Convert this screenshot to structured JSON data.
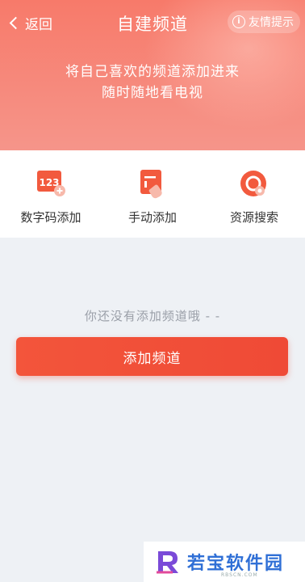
{
  "header": {
    "back_label": "返回",
    "title": "自建频道",
    "tip_label": "友情提示",
    "slogan_line1": "将自己喜欢的频道添加进来",
    "slogan_line2": "随时随地看电视"
  },
  "actions": [
    {
      "label": "数字码添加",
      "icon": "number-code-icon",
      "icon_text": "123"
    },
    {
      "label": "手动添加",
      "icon": "manual-add-icon"
    },
    {
      "label": "资源搜索",
      "icon": "resource-search-icon"
    }
  ],
  "empty": {
    "text": "你还没有添加频道哦 - -",
    "button_label": "添加频道"
  },
  "watermark": {
    "text": "若宝软件园",
    "sub": "RBSCN.COM"
  },
  "colors": {
    "header": "#f77a6a",
    "accent": "#ef4a36",
    "background": "#eef1f5"
  }
}
